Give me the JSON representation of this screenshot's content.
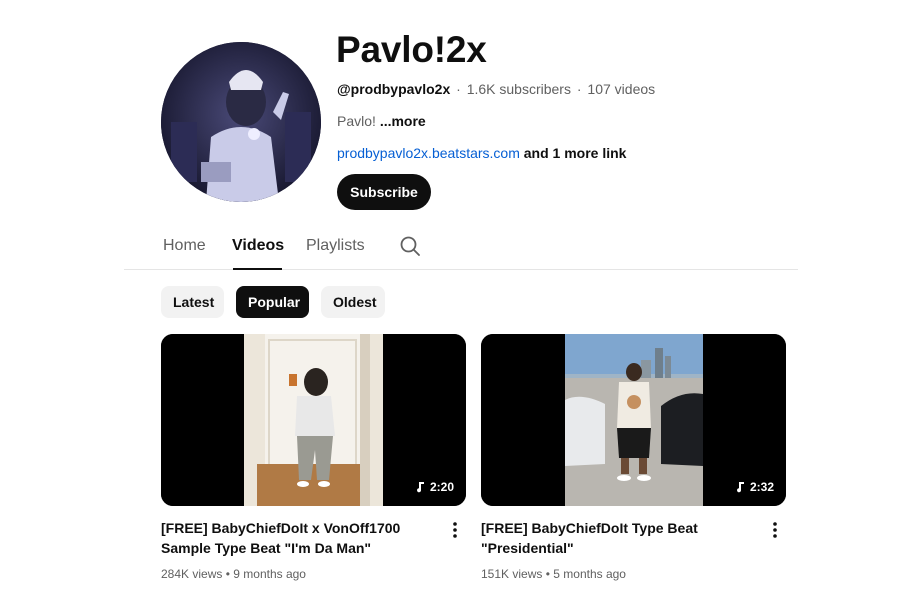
{
  "channel": {
    "name": "Pavlo!2x",
    "handle": "@prodbypavlo2x",
    "separator": "·",
    "subscribers": "1.6K subscribers",
    "videos_count": "107 videos",
    "description": "Pavlo!",
    "description_more": "...more",
    "link": "prodbypavlo2x.beatstars.com",
    "more_links": "and 1 more link",
    "subscribe_label": "Subscribe"
  },
  "tabs": [
    {
      "label": "Home",
      "active": false
    },
    {
      "label": "Videos",
      "active": true
    },
    {
      "label": "Playlists",
      "active": false
    }
  ],
  "filters": [
    {
      "label": "Latest",
      "active": false
    },
    {
      "label": "Popular",
      "active": true
    },
    {
      "label": "Oldest",
      "active": false
    }
  ],
  "videos": [
    {
      "title": "[FREE] BabyChiefDoIt x VonOff1700 Sample Type Beat \"I'm Da Man\"",
      "duration": "2:20",
      "views": "284K views",
      "separator": "•",
      "age": "9 months ago"
    },
    {
      "title": "[FREE] BabyChiefDoIt Type Beat \"Presidential\"",
      "duration": "2:32",
      "views": "151K views",
      "separator": "•",
      "age": "5 months ago"
    }
  ],
  "icons": {
    "search": "search-icon",
    "music_note": "music-note-icon",
    "more": "more-vert-icon"
  },
  "colors": {
    "text": "#0f0f0f",
    "secondary": "#606060",
    "link": "#065fd4",
    "chip_bg": "#f2f2f2"
  }
}
